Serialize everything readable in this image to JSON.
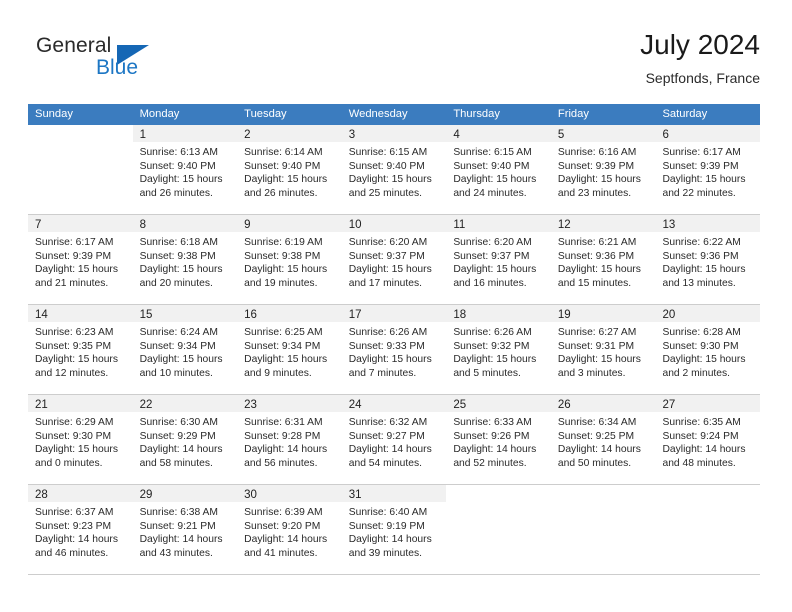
{
  "brand": {
    "name_part1": "General",
    "name_part2": "Blue",
    "accent_color": "#1567b5"
  },
  "header": {
    "title": "July 2024",
    "subtitle": "Septfonds, France"
  },
  "theme": {
    "header_blue": "#3b7cbf",
    "day_band_gray": "#f1f1f1",
    "row_border": "#cdcdcd"
  },
  "weekdays": [
    "Sunday",
    "Monday",
    "Tuesday",
    "Wednesday",
    "Thursday",
    "Friday",
    "Saturday"
  ],
  "weeks": [
    [
      {
        "day": "",
        "lines": []
      },
      {
        "day": "1",
        "lines": [
          "Sunrise: 6:13 AM",
          "Sunset: 9:40 PM",
          "Daylight: 15 hours",
          "and 26 minutes."
        ]
      },
      {
        "day": "2",
        "lines": [
          "Sunrise: 6:14 AM",
          "Sunset: 9:40 PM",
          "Daylight: 15 hours",
          "and 26 minutes."
        ]
      },
      {
        "day": "3",
        "lines": [
          "Sunrise: 6:15 AM",
          "Sunset: 9:40 PM",
          "Daylight: 15 hours",
          "and 25 minutes."
        ]
      },
      {
        "day": "4",
        "lines": [
          "Sunrise: 6:15 AM",
          "Sunset: 9:40 PM",
          "Daylight: 15 hours",
          "and 24 minutes."
        ]
      },
      {
        "day": "5",
        "lines": [
          "Sunrise: 6:16 AM",
          "Sunset: 9:39 PM",
          "Daylight: 15 hours",
          "and 23 minutes."
        ]
      },
      {
        "day": "6",
        "lines": [
          "Sunrise: 6:17 AM",
          "Sunset: 9:39 PM",
          "Daylight: 15 hours",
          "and 22 minutes."
        ]
      }
    ],
    [
      {
        "day": "7",
        "lines": [
          "Sunrise: 6:17 AM",
          "Sunset: 9:39 PM",
          "Daylight: 15 hours",
          "and 21 minutes."
        ]
      },
      {
        "day": "8",
        "lines": [
          "Sunrise: 6:18 AM",
          "Sunset: 9:38 PM",
          "Daylight: 15 hours",
          "and 20 minutes."
        ]
      },
      {
        "day": "9",
        "lines": [
          "Sunrise: 6:19 AM",
          "Sunset: 9:38 PM",
          "Daylight: 15 hours",
          "and 19 minutes."
        ]
      },
      {
        "day": "10",
        "lines": [
          "Sunrise: 6:20 AM",
          "Sunset: 9:37 PM",
          "Daylight: 15 hours",
          "and 17 minutes."
        ]
      },
      {
        "day": "11",
        "lines": [
          "Sunrise: 6:20 AM",
          "Sunset: 9:37 PM",
          "Daylight: 15 hours",
          "and 16 minutes."
        ]
      },
      {
        "day": "12",
        "lines": [
          "Sunrise: 6:21 AM",
          "Sunset: 9:36 PM",
          "Daylight: 15 hours",
          "and 15 minutes."
        ]
      },
      {
        "day": "13",
        "lines": [
          "Sunrise: 6:22 AM",
          "Sunset: 9:36 PM",
          "Daylight: 15 hours",
          "and 13 minutes."
        ]
      }
    ],
    [
      {
        "day": "14",
        "lines": [
          "Sunrise: 6:23 AM",
          "Sunset: 9:35 PM",
          "Daylight: 15 hours",
          "and 12 minutes."
        ]
      },
      {
        "day": "15",
        "lines": [
          "Sunrise: 6:24 AM",
          "Sunset: 9:34 PM",
          "Daylight: 15 hours",
          "and 10 minutes."
        ]
      },
      {
        "day": "16",
        "lines": [
          "Sunrise: 6:25 AM",
          "Sunset: 9:34 PM",
          "Daylight: 15 hours",
          "and 9 minutes."
        ]
      },
      {
        "day": "17",
        "lines": [
          "Sunrise: 6:26 AM",
          "Sunset: 9:33 PM",
          "Daylight: 15 hours",
          "and 7 minutes."
        ]
      },
      {
        "day": "18",
        "lines": [
          "Sunrise: 6:26 AM",
          "Sunset: 9:32 PM",
          "Daylight: 15 hours",
          "and 5 minutes."
        ]
      },
      {
        "day": "19",
        "lines": [
          "Sunrise: 6:27 AM",
          "Sunset: 9:31 PM",
          "Daylight: 15 hours",
          "and 3 minutes."
        ]
      },
      {
        "day": "20",
        "lines": [
          "Sunrise: 6:28 AM",
          "Sunset: 9:30 PM",
          "Daylight: 15 hours",
          "and 2 minutes."
        ]
      }
    ],
    [
      {
        "day": "21",
        "lines": [
          "Sunrise: 6:29 AM",
          "Sunset: 9:30 PM",
          "Daylight: 15 hours",
          "and 0 minutes."
        ]
      },
      {
        "day": "22",
        "lines": [
          "Sunrise: 6:30 AM",
          "Sunset: 9:29 PM",
          "Daylight: 14 hours",
          "and 58 minutes."
        ]
      },
      {
        "day": "23",
        "lines": [
          "Sunrise: 6:31 AM",
          "Sunset: 9:28 PM",
          "Daylight: 14 hours",
          "and 56 minutes."
        ]
      },
      {
        "day": "24",
        "lines": [
          "Sunrise: 6:32 AM",
          "Sunset: 9:27 PM",
          "Daylight: 14 hours",
          "and 54 minutes."
        ]
      },
      {
        "day": "25",
        "lines": [
          "Sunrise: 6:33 AM",
          "Sunset: 9:26 PM",
          "Daylight: 14 hours",
          "and 52 minutes."
        ]
      },
      {
        "day": "26",
        "lines": [
          "Sunrise: 6:34 AM",
          "Sunset: 9:25 PM",
          "Daylight: 14 hours",
          "and 50 minutes."
        ]
      },
      {
        "day": "27",
        "lines": [
          "Sunrise: 6:35 AM",
          "Sunset: 9:24 PM",
          "Daylight: 14 hours",
          "and 48 minutes."
        ]
      }
    ],
    [
      {
        "day": "28",
        "lines": [
          "Sunrise: 6:37 AM",
          "Sunset: 9:23 PM",
          "Daylight: 14 hours",
          "and 46 minutes."
        ]
      },
      {
        "day": "29",
        "lines": [
          "Sunrise: 6:38 AM",
          "Sunset: 9:21 PM",
          "Daylight: 14 hours",
          "and 43 minutes."
        ]
      },
      {
        "day": "30",
        "lines": [
          "Sunrise: 6:39 AM",
          "Sunset: 9:20 PM",
          "Daylight: 14 hours",
          "and 41 minutes."
        ]
      },
      {
        "day": "31",
        "lines": [
          "Sunrise: 6:40 AM",
          "Sunset: 9:19 PM",
          "Daylight: 14 hours",
          "and 39 minutes."
        ]
      },
      {
        "day": "",
        "lines": []
      },
      {
        "day": "",
        "lines": []
      },
      {
        "day": "",
        "lines": []
      }
    ]
  ]
}
